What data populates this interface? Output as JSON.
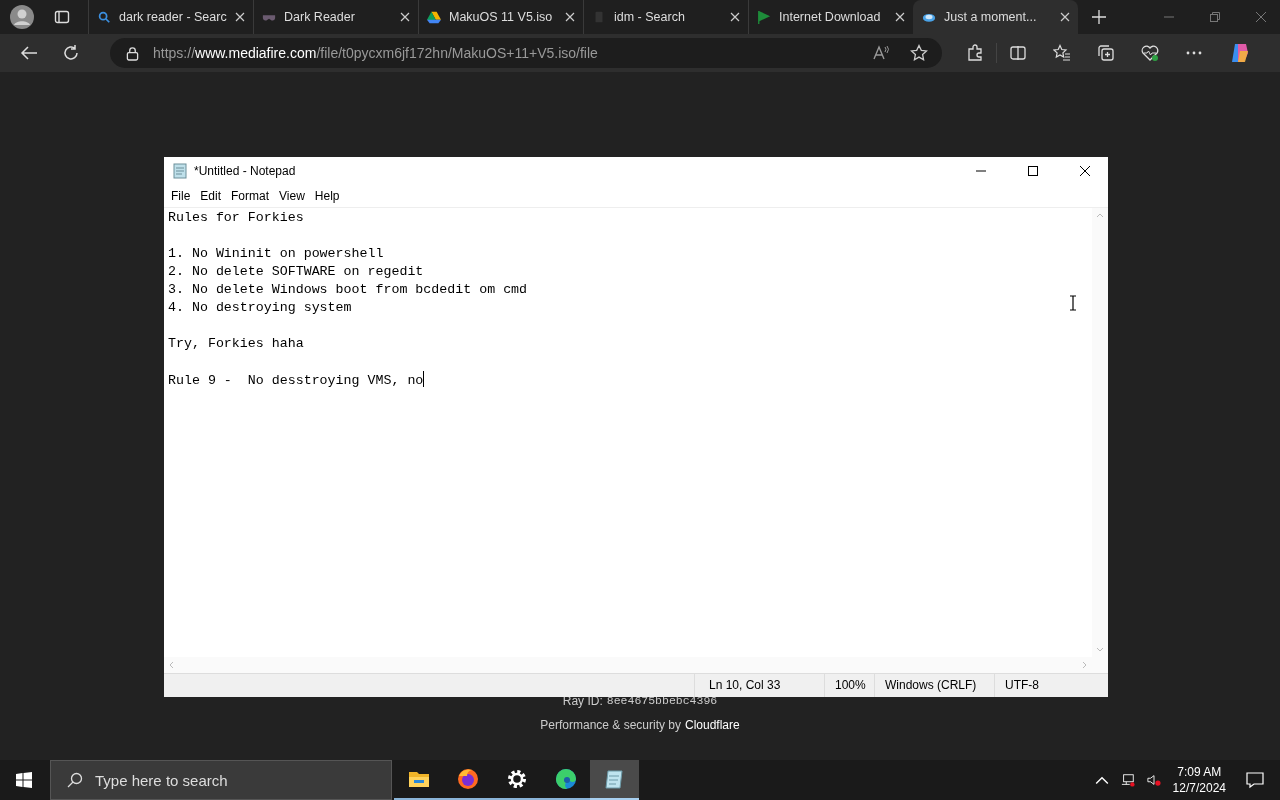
{
  "browser": {
    "tabs": [
      {
        "kind": "search",
        "label": "dark reader - Searc",
        "selected": false
      },
      {
        "kind": "mask",
        "label": "Dark Reader",
        "selected": false
      },
      {
        "kind": "drive",
        "label": "MakuOS 11 V5.iso",
        "selected": false
      },
      {
        "kind": "blank",
        "label": "idm - Search",
        "selected": false
      },
      {
        "kind": "flag",
        "label": "Internet Download",
        "selected": false
      },
      {
        "kind": "cloud",
        "label": "Just a moment...",
        "selected": true
      }
    ],
    "url": {
      "scheme": "https://",
      "host": "www.mediafire.com",
      "path": "/file/t0pycxm6jf172hn/MakuOS+11+V5.iso/file"
    }
  },
  "page": {
    "ray_label": "Ray ID:",
    "ray_id": "8ee4675bbebc4396",
    "footer": "Performance & security by",
    "footer_link": "Cloudflare"
  },
  "notepad": {
    "title": "*Untitled - Notepad",
    "menu": [
      "File",
      "Edit",
      "Format",
      "View",
      "Help"
    ],
    "blocks": [
      [
        "Rules for Forkies"
      ],
      [
        "1. No Wininit on powershell",
        "2. No delete SOFTWARE on regedit",
        "3. No delete Windows boot from bcdedit om cmd",
        "4. No destroying system"
      ],
      [
        "Try, Forkies haha"
      ],
      [
        "Rule 9 -  No desstroying VMS, no"
      ]
    ],
    "caret": true,
    "status": {
      "position": "Ln 10, Col 33",
      "zoom": "100%",
      "line_ending": "Windows (CRLF)",
      "encoding": "UTF-8"
    }
  },
  "taskbar": {
    "search_placeholder": "Type here to search",
    "apps": [
      {
        "kind": "explorer",
        "selected": false
      },
      {
        "kind": "firefox",
        "selected": false
      },
      {
        "kind": "settings",
        "selected": false
      },
      {
        "kind": "edge",
        "selected": false
      },
      {
        "kind": "notepad",
        "selected": true
      }
    ],
    "time": "7:09 AM",
    "date": "12/7/2024"
  }
}
